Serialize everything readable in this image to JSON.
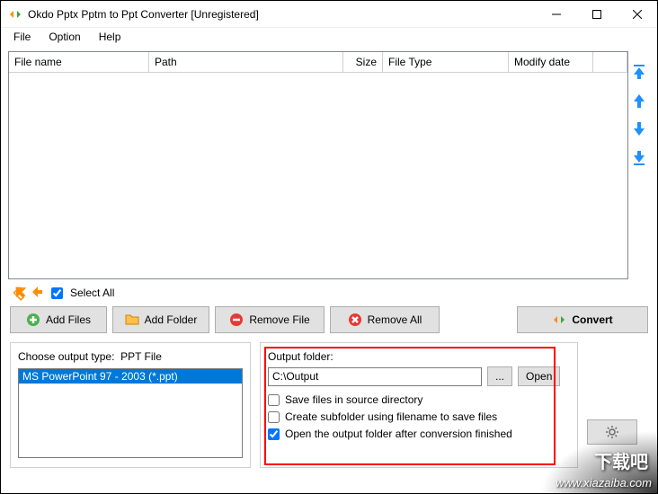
{
  "window": {
    "title": "Okdo Pptx Pptm to Ppt Converter [Unregistered]"
  },
  "menu": {
    "file": "File",
    "option": "Option",
    "help": "Help"
  },
  "columns": {
    "filename": "File name",
    "path": "Path",
    "size": "Size",
    "filetype": "File Type",
    "modifydate": "Modify date"
  },
  "selectall": {
    "label": "Select All",
    "checked": true
  },
  "buttons": {
    "addfiles": "Add Files",
    "addfolder": "Add Folder",
    "removefile": "Remove File",
    "removeall": "Remove All",
    "convert": "Convert",
    "browse": "...",
    "open": "Open"
  },
  "outputtype": {
    "label": "Choose output type:",
    "current": "PPT File",
    "items": [
      "MS PowerPoint 97 - 2003 (*.ppt)"
    ]
  },
  "outputfolder": {
    "label": "Output folder:",
    "value": "C:\\Output",
    "saveinsource": {
      "label": "Save files in source directory",
      "checked": false
    },
    "subfolder": {
      "label": "Create subfolder using filename to save files",
      "checked": false
    },
    "openafter": {
      "label": "Open the output folder after conversion finished",
      "checked": true
    }
  },
  "watermark": {
    "cn": "下载吧",
    "url": "www.xiazaiba.com"
  }
}
